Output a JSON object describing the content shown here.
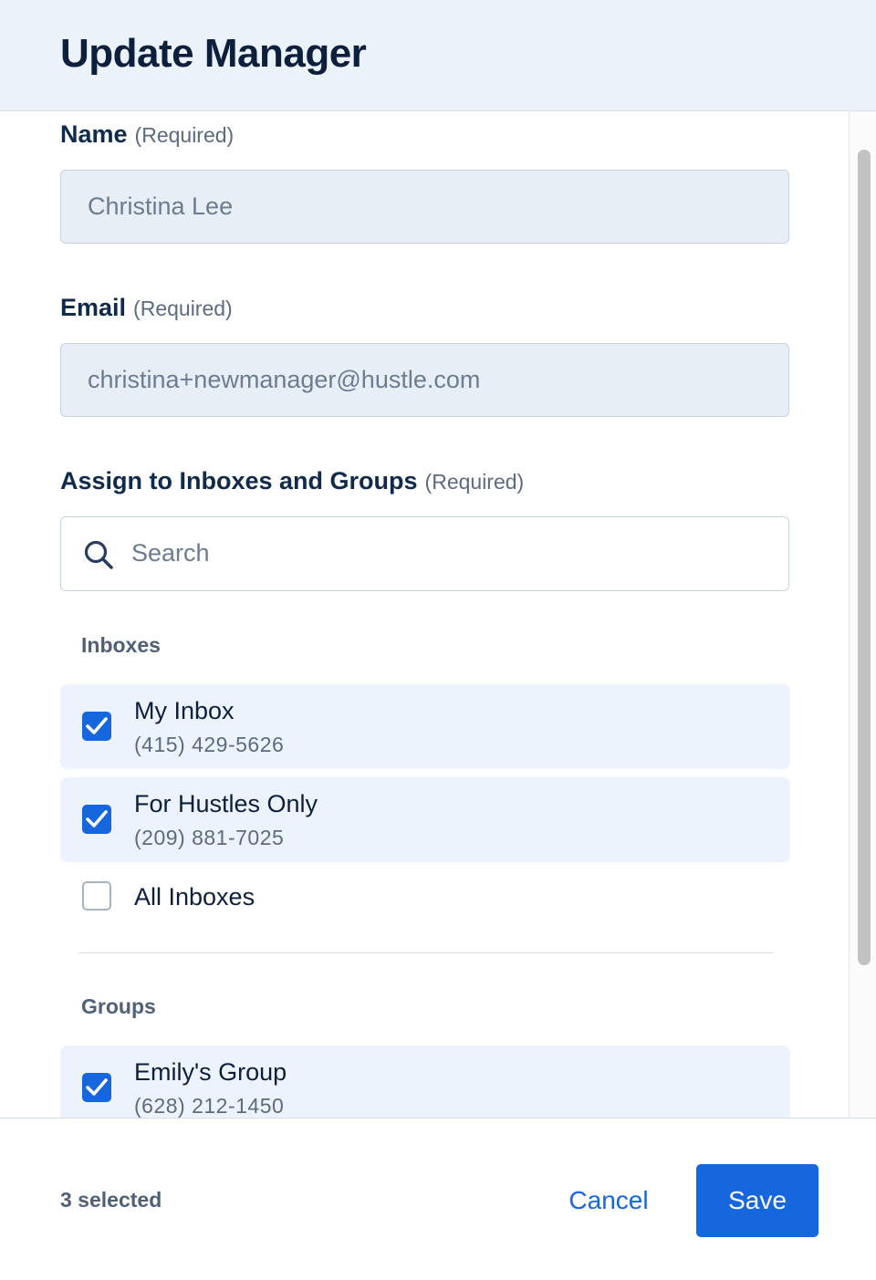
{
  "header": {
    "title": "Update Manager"
  },
  "form": {
    "name": {
      "label": "Name",
      "required_note": "(Required)",
      "value": "Christina Lee"
    },
    "email": {
      "label": "Email",
      "required_note": "(Required)",
      "value": "christina+newmanager@hustle.com"
    },
    "assign": {
      "label": "Assign to Inboxes and Groups",
      "required_note": "(Required)"
    },
    "search": {
      "placeholder": "Search",
      "icon": "search-icon"
    }
  },
  "inboxes": {
    "heading": "Inboxes",
    "items": [
      {
        "title": "My Inbox",
        "phone": "(415) 429-5626",
        "checked": true
      },
      {
        "title": "For Hustles Only",
        "phone": "(209) 881-7025",
        "checked": true
      },
      {
        "title": "All Inboxes",
        "checked": false
      }
    ]
  },
  "groups": {
    "heading": "Groups",
    "items": [
      {
        "title": "Emily's Group",
        "phone": "(628) 212-1450",
        "checked": true
      }
    ]
  },
  "footer": {
    "selected_count": "3 selected",
    "cancel_label": "Cancel",
    "save_label": "Save"
  },
  "colors": {
    "accent": "#1666dd",
    "header_bg": "#ecf2f9",
    "checked_row_bg": "#edf3fd",
    "readonly_input_bg": "#e8eef6"
  }
}
